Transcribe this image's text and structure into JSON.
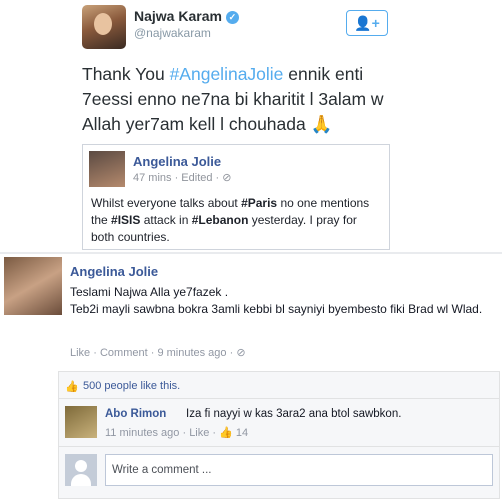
{
  "tweet": {
    "name": "Najwa Karam",
    "verified_icon": "verified-check-icon",
    "handle": "@najwakaram",
    "follow_icon": "follow-person-plus-icon",
    "text_part1": "Thank You ",
    "hashtag": "#AngelinaJolie",
    "text_part2": " ennik enti 7eessi enno ne7na bi kharitit l 3alam w Allah yer7am kell l chouhada ",
    "emoji": "🙏",
    "embed": {
      "name": "Angelina Jolie",
      "meta": "47 mins · Edited · ",
      "globe_icon": "globe-icon",
      "t1": "Whilst everyone talks about ",
      "b1": "#Paris",
      "t2": " no one mentions the ",
      "b2": "#ISIS",
      "t3": " attack in ",
      "b3": "#Lebanon",
      "t4": " yesterday. I pray for both countries."
    }
  },
  "comment": {
    "name": "Angelina Jolie",
    "line1": "Teslami Najwa Alla ye7fazek .",
    "line2": "Teb2i mayli sawbna bokra 3amli kebbi bl sayniyi byembesto fiki Brad wl Wlad.",
    "like": "Like",
    "comment_link": "Comment",
    "time": "9 minutes ago",
    "likes_count": "500 people like this.",
    "reply": {
      "name": "Abo Rimon",
      "text": "Iza fi nayyi w kas 3ara2 ana btol sawbkon.",
      "time": "11 minutes ago",
      "like": "Like",
      "like_count": "14"
    },
    "write_placeholder": "Write a comment ..."
  },
  "colors": {
    "twitter_blue": "#55acee",
    "fb_blue": "#3b5998",
    "meta_gray": "#9197a3"
  }
}
